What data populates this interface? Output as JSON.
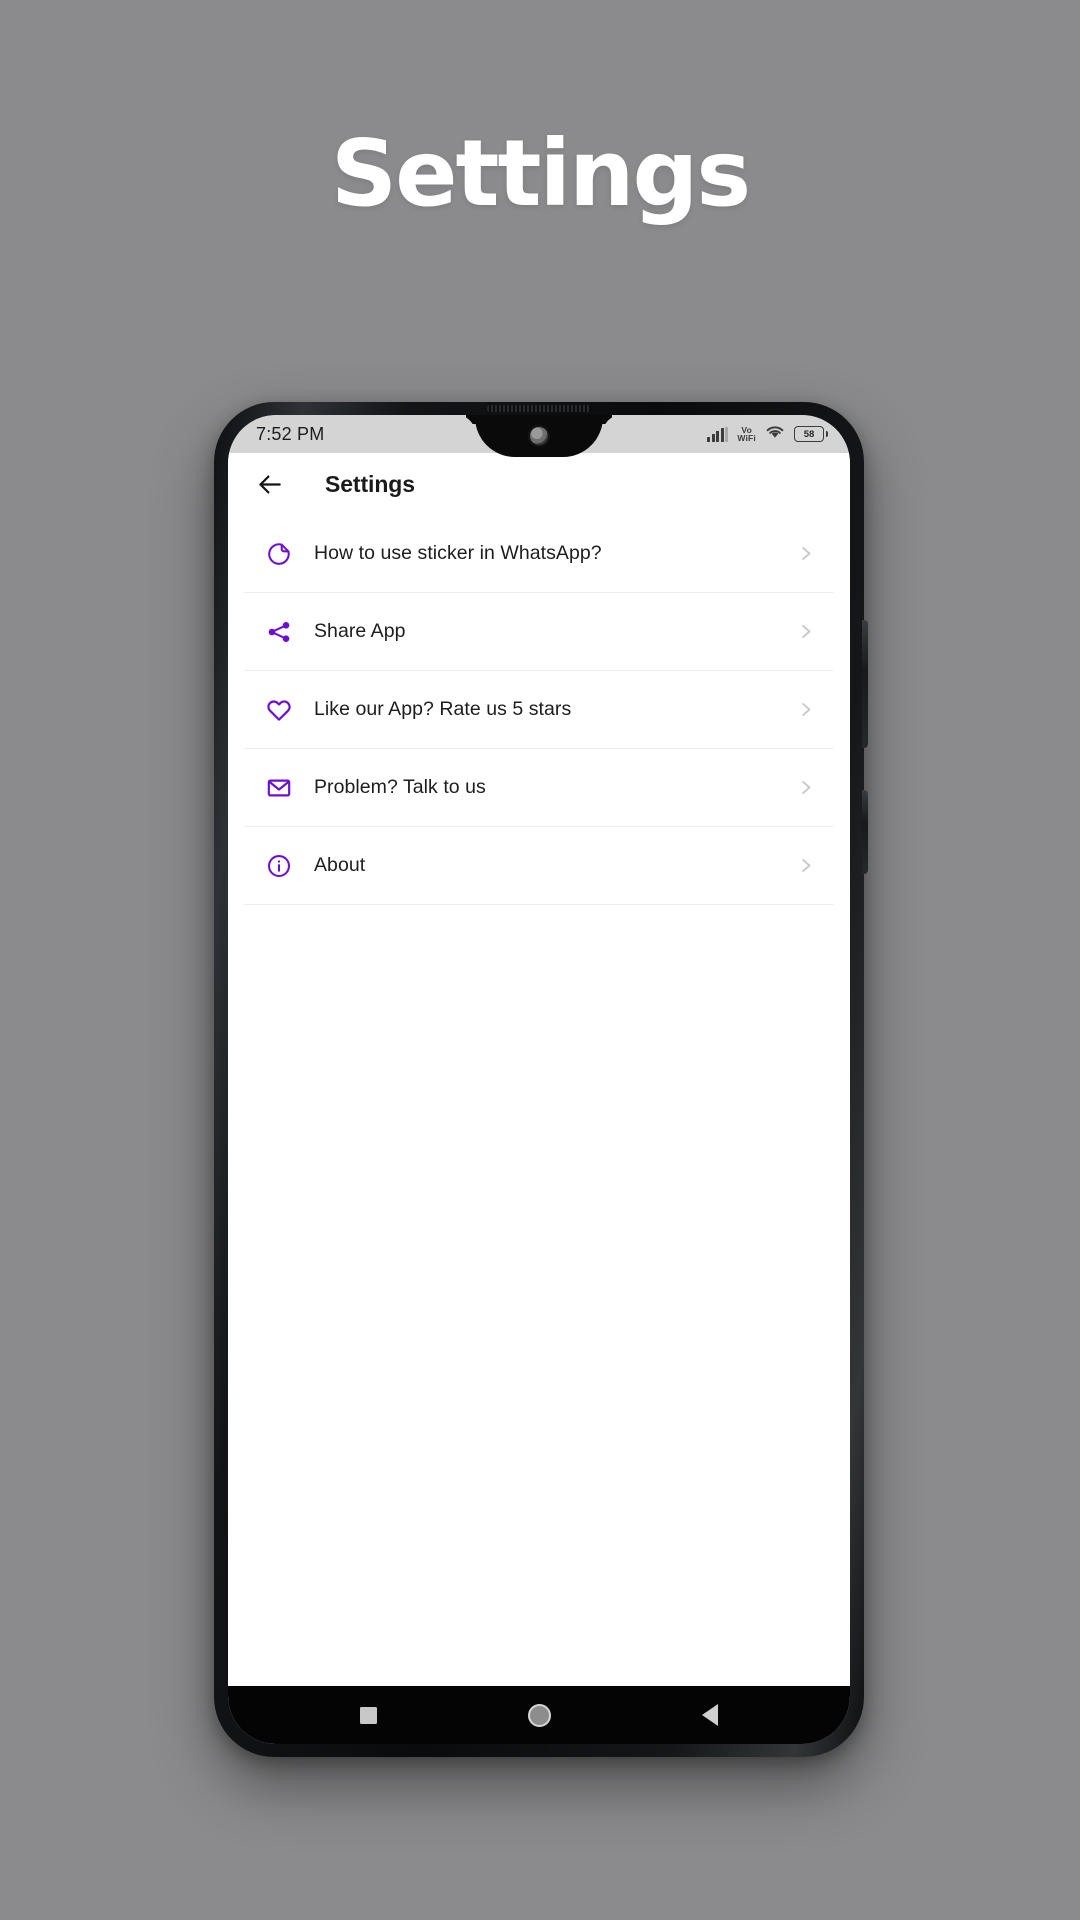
{
  "page": {
    "heading": "Settings",
    "background_color": "#8b8b8d"
  },
  "phone": {
    "status_bar": {
      "time": "7:52 PM",
      "network_label": "Vo",
      "network_label_2": "WiFi",
      "battery_percent": "58",
      "icons": [
        "signal-bars-icon",
        "vowifi-icon",
        "wifi-icon",
        "battery-icon"
      ]
    },
    "app_bar": {
      "back_icon": "back-arrow-icon",
      "title": "Settings"
    },
    "settings_list": [
      {
        "icon": "sticker-icon",
        "label": "How to use sticker in WhatsApp?",
        "chevron": "chevron-right-icon"
      },
      {
        "icon": "share-icon",
        "label": "Share App",
        "chevron": "chevron-right-icon"
      },
      {
        "icon": "heart-icon",
        "label": "Like our App? Rate us 5 stars",
        "chevron": "chevron-right-icon"
      },
      {
        "icon": "mail-icon",
        "label": "Problem? Talk to us",
        "chevron": "chevron-right-icon"
      },
      {
        "icon": "info-icon",
        "label": "About",
        "chevron": "chevron-right-icon"
      }
    ],
    "nav_bar": {
      "recents": "recents-square-icon",
      "home": "home-circle-icon",
      "back": "back-triangle-icon"
    }
  },
  "colors": {
    "accent_purple": "#6d0fd6",
    "app_background": "#ffffff",
    "status_bar_bg": "#d4d4d4",
    "text_primary": "#1d1d1d",
    "chevron_gray": "#c9c9cd",
    "divider": "#efeff1"
  }
}
